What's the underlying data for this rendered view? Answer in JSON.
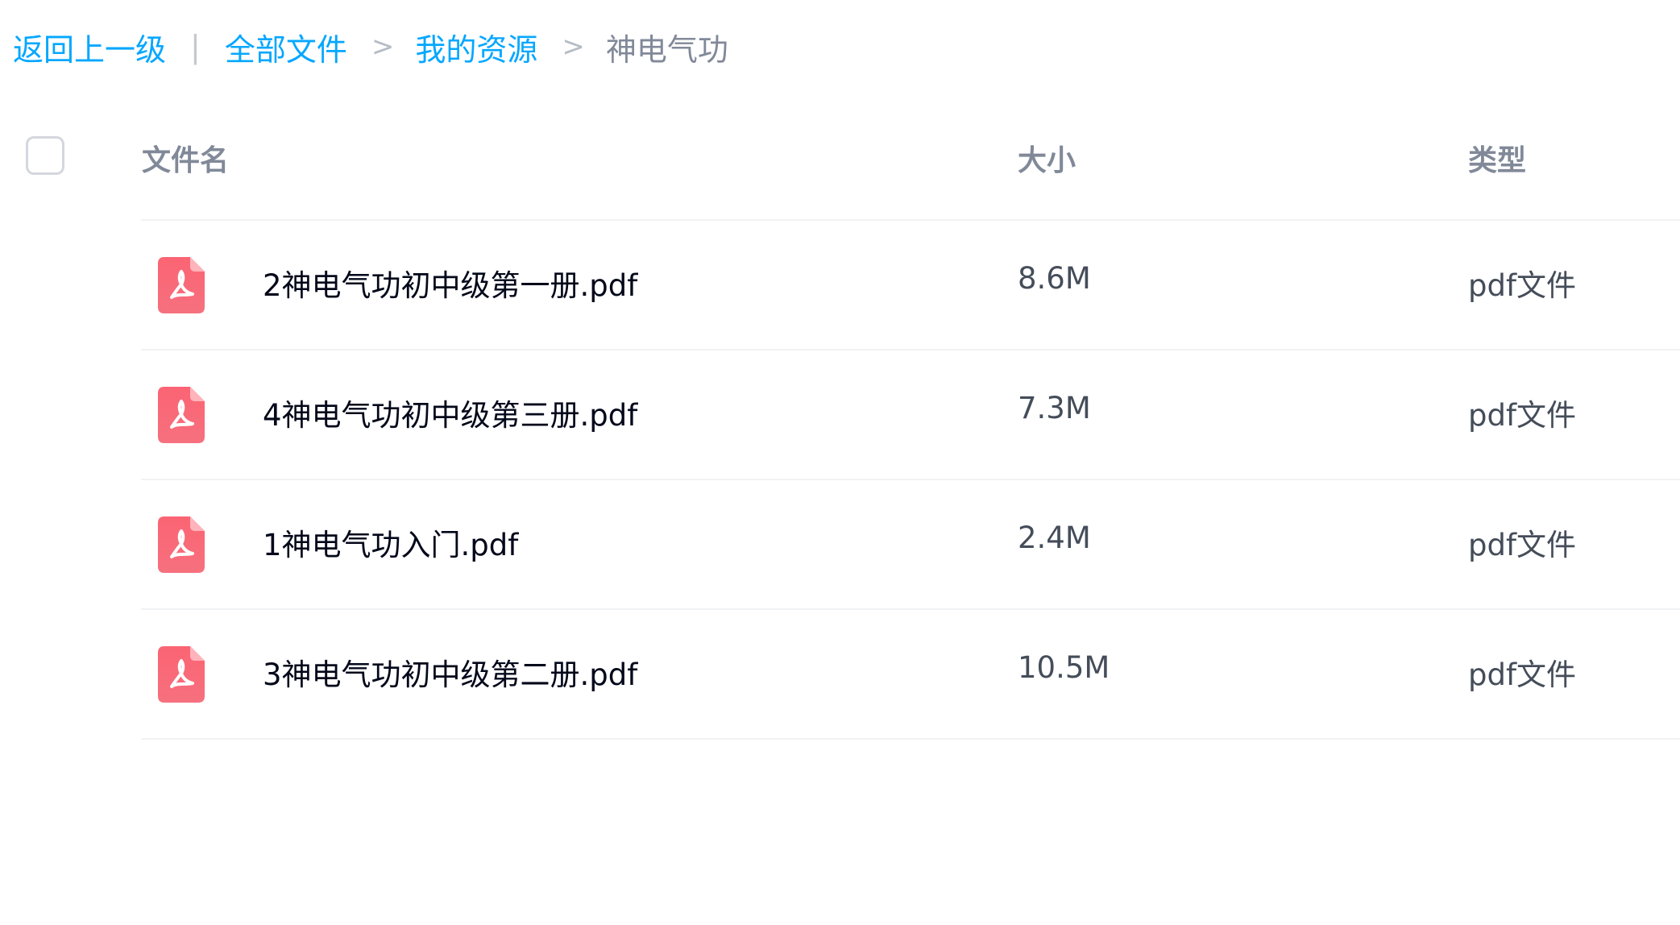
{
  "breadcrumb": {
    "back_label": "返回上一级",
    "divider": "|",
    "separator": ">",
    "items": [
      {
        "label": "全部文件",
        "is_link": true
      },
      {
        "label": "我的资源",
        "is_link": true
      },
      {
        "label": "神电气功",
        "is_link": false
      }
    ]
  },
  "table": {
    "columns": {
      "name": "文件名",
      "size": "大小",
      "type": "类型"
    },
    "rows": [
      {
        "name": "2神电气功初中级第一册.pdf",
        "size": "8.6M",
        "type": "pdf文件",
        "icon": "pdf-file-icon"
      },
      {
        "name": "4神电气功初中级第三册.pdf",
        "size": "7.3M",
        "type": "pdf文件",
        "icon": "pdf-file-icon"
      },
      {
        "name": "1神电气功入门.pdf",
        "size": "2.4M",
        "type": "pdf文件",
        "icon": "pdf-file-icon"
      },
      {
        "name": "3神电气功初中级第二册.pdf",
        "size": "10.5M",
        "type": "pdf文件",
        "icon": "pdf-file-icon"
      }
    ]
  },
  "colors": {
    "link": "#06a7ff",
    "muted": "#818999",
    "pdf_icon": "#fa5a6a",
    "divider": "#f1f2f4"
  }
}
